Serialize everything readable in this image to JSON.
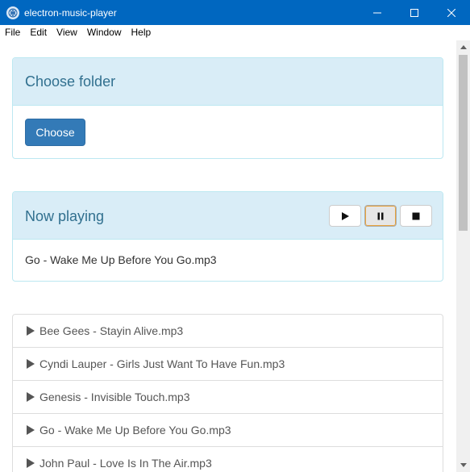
{
  "window": {
    "title": "electron-music-player"
  },
  "menu": [
    "File",
    "Edit",
    "View",
    "Window",
    "Help"
  ],
  "folder_panel": {
    "title": "Choose folder",
    "button_label": "Choose"
  },
  "now_playing": {
    "title": "Now playing",
    "track": "Go - Wake Me Up Before You Go.mp3",
    "active_control": "pause"
  },
  "tracks": [
    "Bee Gees - Stayin Alive.mp3",
    "Cyndi Lauper - Girls Just Want To Have Fun.mp3",
    "Genesis - Invisible Touch.mp3",
    "Go - Wake Me Up Before You Go.mp3",
    "John Paul - Love Is In The Air.mp3"
  ]
}
